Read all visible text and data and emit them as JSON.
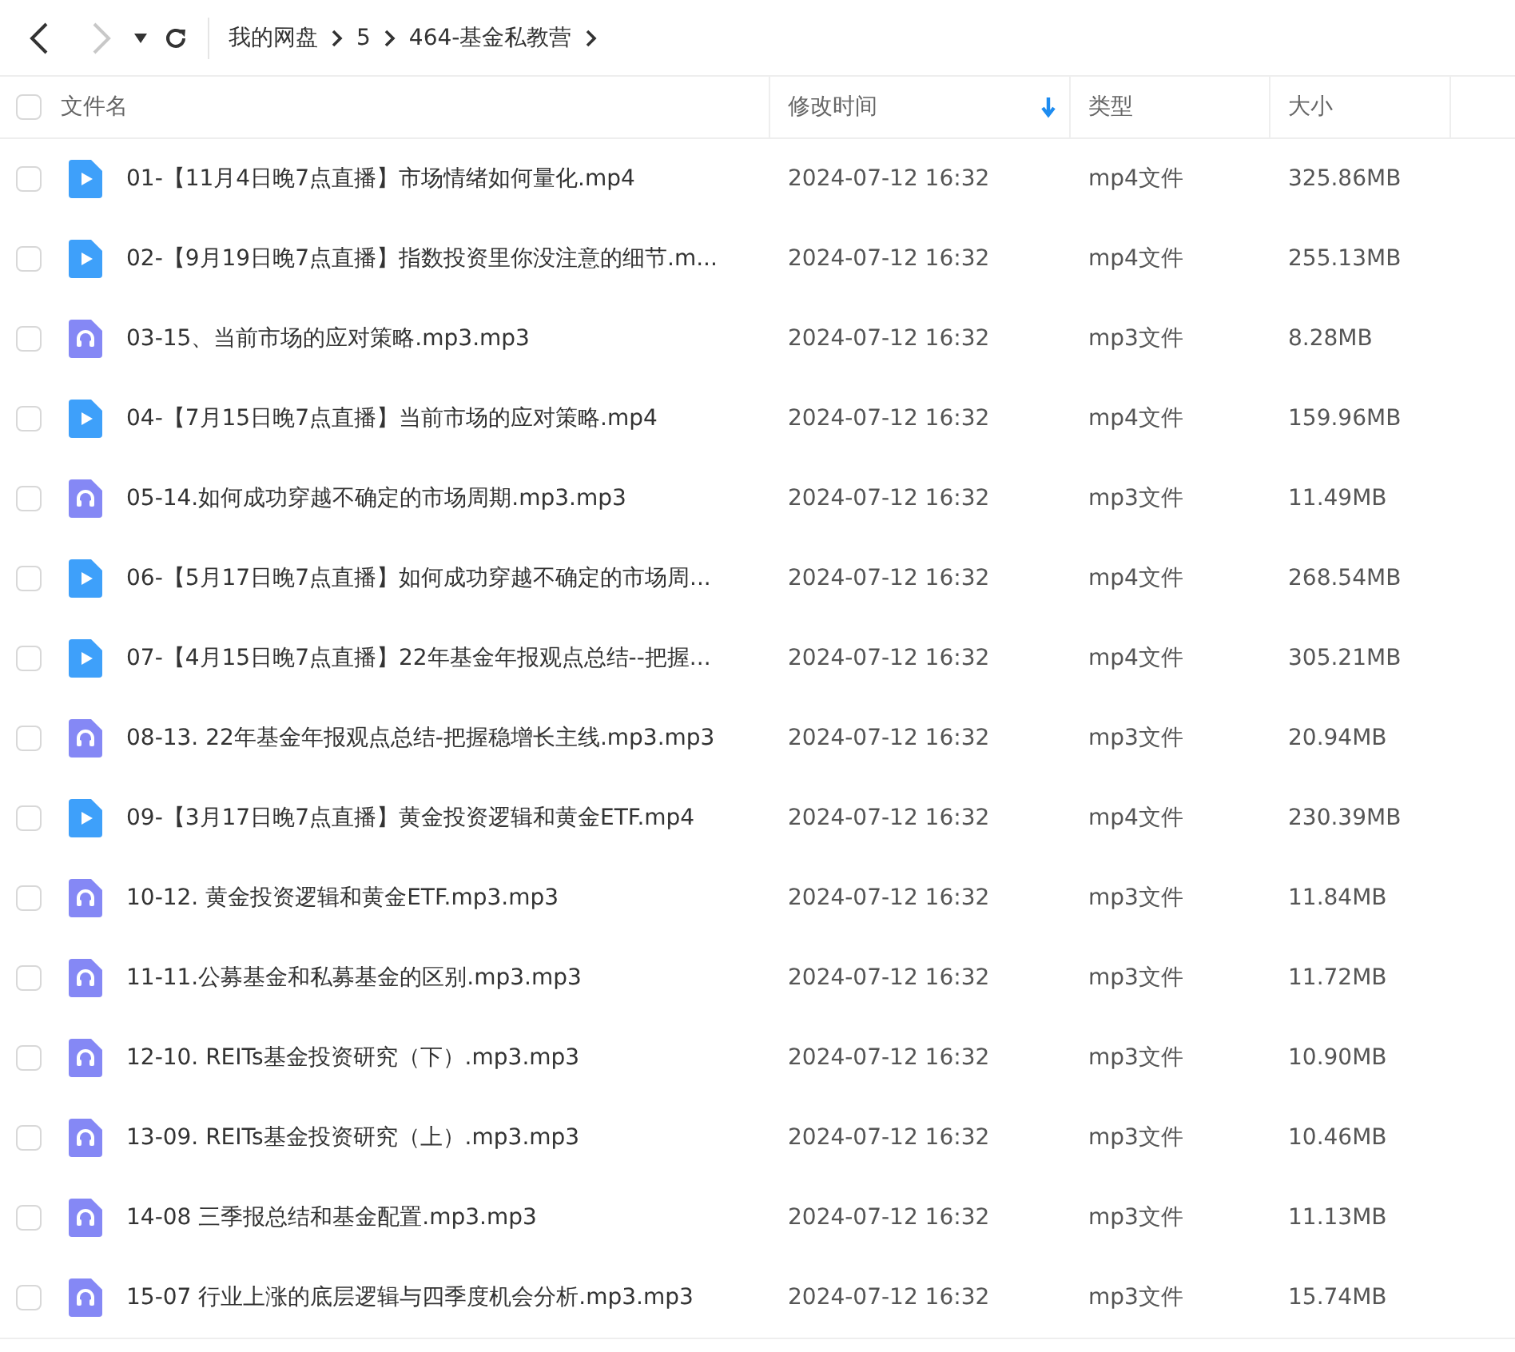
{
  "toolbar": {
    "back": {
      "disabled": false
    },
    "forward": {
      "disabled": true
    },
    "breadcrumb": [
      "我的网盘",
      "5",
      "464-基金私教营"
    ]
  },
  "table": {
    "select_all": {
      "checked": false
    },
    "columns": [
      {
        "label": "文件名",
        "sorted": false
      },
      {
        "label": "修改时间",
        "sorted": true
      },
      {
        "label": "类型",
        "sorted": false
      },
      {
        "label": "大小",
        "sorted": false
      }
    ],
    "rows": [
      {
        "kind": "video",
        "checked": false,
        "name": "01-【11月4日晚7点直播】市场情绪如何量化.mp4",
        "modified": "2024-07-12 16:32",
        "type": "mp4文件",
        "size": "325.86MB"
      },
      {
        "kind": "video",
        "checked": false,
        "name": "02-【9月19日晚7点直播】指数投资里你没注意的细节.m...",
        "modified": "2024-07-12 16:32",
        "type": "mp4文件",
        "size": "255.13MB"
      },
      {
        "kind": "audio",
        "checked": false,
        "name": "03-15、当前市场的应对策略.mp3.mp3",
        "modified": "2024-07-12 16:32",
        "type": "mp3文件",
        "size": "8.28MB"
      },
      {
        "kind": "video",
        "checked": false,
        "name": "04-【7月15日晚7点直播】当前市场的应对策略.mp4",
        "modified": "2024-07-12 16:32",
        "type": "mp4文件",
        "size": "159.96MB"
      },
      {
        "kind": "audio",
        "checked": false,
        "name": "05-14.如何成功穿越不确定的市场周期.mp3.mp3",
        "modified": "2024-07-12 16:32",
        "type": "mp3文件",
        "size": "11.49MB"
      },
      {
        "kind": "video",
        "checked": false,
        "name": "06-【5月17日晚7点直播】如何成功穿越不确定的市场周...",
        "modified": "2024-07-12 16:32",
        "type": "mp4文件",
        "size": "268.54MB"
      },
      {
        "kind": "video",
        "checked": false,
        "name": "07-【4月15日晚7点直播】22年基金年报观点总结--把握...",
        "modified": "2024-07-12 16:32",
        "type": "mp4文件",
        "size": "305.21MB"
      },
      {
        "kind": "audio",
        "checked": false,
        "name": "08-13. 22年基金年报观点总结-把握稳增长主线.mp3.mp3",
        "modified": "2024-07-12 16:32",
        "type": "mp3文件",
        "size": "20.94MB"
      },
      {
        "kind": "video",
        "checked": false,
        "name": "09-【3月17日晚7点直播】黄金投资逻辑和黄金ETF.mp4",
        "modified": "2024-07-12 16:32",
        "type": "mp4文件",
        "size": "230.39MB"
      },
      {
        "kind": "audio",
        "checked": false,
        "name": "10-12. 黄金投资逻辑和黄金ETF.mp3.mp3",
        "modified": "2024-07-12 16:32",
        "type": "mp3文件",
        "size": "11.84MB"
      },
      {
        "kind": "audio",
        "checked": false,
        "name": "11-11.公募基金和私募基金的区别.mp3.mp3",
        "modified": "2024-07-12 16:32",
        "type": "mp3文件",
        "size": "11.72MB"
      },
      {
        "kind": "audio",
        "checked": false,
        "name": "12-10. REITs基金投资研究（下）.mp3.mp3",
        "modified": "2024-07-12 16:32",
        "type": "mp3文件",
        "size": "10.90MB"
      },
      {
        "kind": "audio",
        "checked": false,
        "name": "13-09. REITs基金投资研究（上）.mp3.mp3",
        "modified": "2024-07-12 16:32",
        "type": "mp3文件",
        "size": "10.46MB"
      },
      {
        "kind": "audio",
        "checked": false,
        "name": "14-08 三季报总结和基金配置.mp3.mp3",
        "modified": "2024-07-12 16:32",
        "type": "mp3文件",
        "size": "11.13MB"
      },
      {
        "kind": "audio",
        "checked": false,
        "name": "15-07 行业上涨的底层逻辑与四季度机会分析.mp3.mp3",
        "modified": "2024-07-12 16:32",
        "type": "mp3文件",
        "size": "15.74MB"
      }
    ]
  }
}
